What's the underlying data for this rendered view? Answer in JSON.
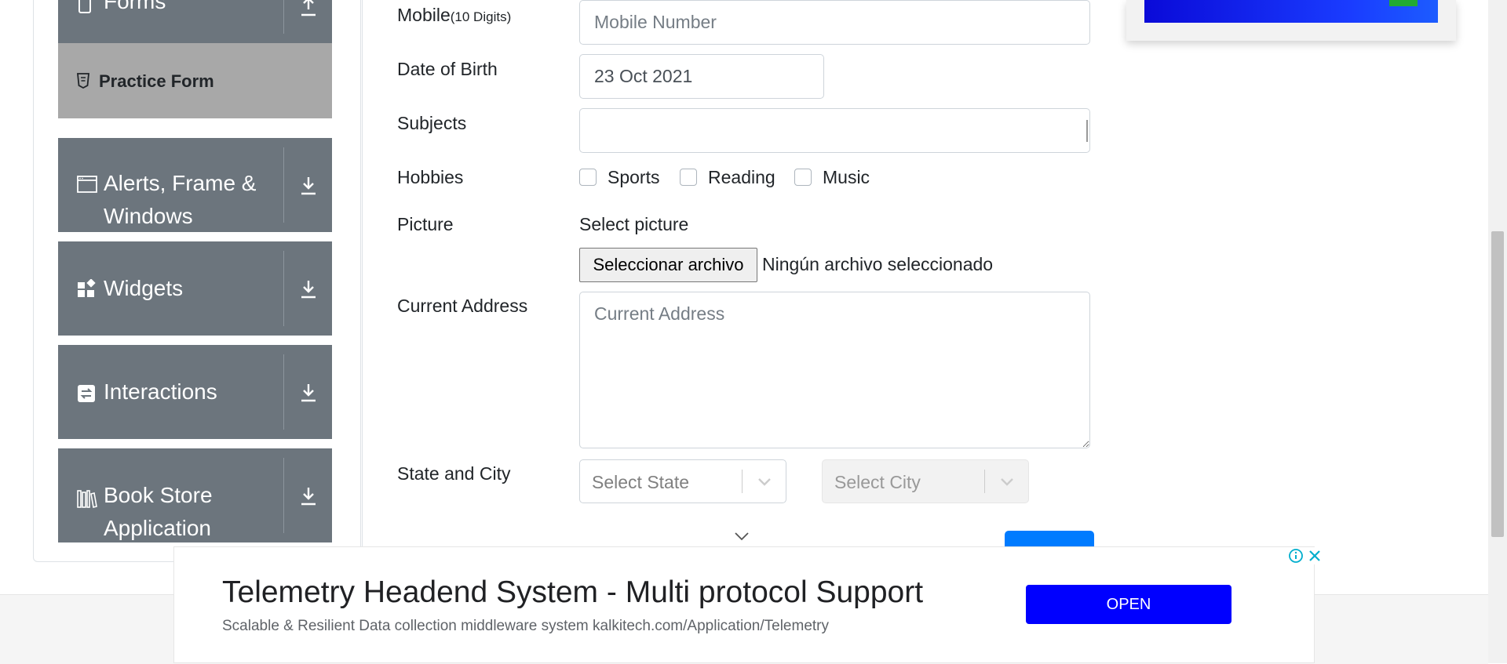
{
  "sidebar": {
    "forms_label": "Forms",
    "practice_form_label": "Practice Form",
    "groups": [
      {
        "label_line1": "Alerts, Frame &",
        "label_line2": "Windows",
        "icon": "window-icon"
      },
      {
        "label_line1": "Widgets",
        "label_line2": "",
        "icon": "widgets-icon"
      },
      {
        "label_line1": "Interactions",
        "label_line2": "",
        "icon": "interactions-icon"
      },
      {
        "label_line1": "Book Store",
        "label_line2": "Application",
        "icon": "book-store-icon"
      }
    ]
  },
  "form": {
    "mobile_label": "Mobile",
    "mobile_hint": "(10 Digits)",
    "mobile_placeholder": "Mobile Number",
    "dob_label": "Date of Birth",
    "dob_value": "23 Oct 2021",
    "subjects_label": "Subjects",
    "subjects_value": "",
    "hobbies_label": "Hobbies",
    "hobbies": [
      "Sports",
      "Reading",
      "Music"
    ],
    "picture_label": "Picture",
    "select_picture_label": "Select picture",
    "file_button_label": "Seleccionar archivo",
    "file_status": "Ningún archivo seleccionado",
    "address_label": "Current Address",
    "address_placeholder": "Current Address",
    "state_city_label": "State and City",
    "state_placeholder": "Select State",
    "city_placeholder": "Select City"
  },
  "ad": {
    "title": "Telemetry Headend System - Multi protocol Support",
    "subtitle": "Scalable & Resilient Data collection middleware system kalkitech.com/Application/Telemetry",
    "button_label": "OPEN"
  },
  "colors": {
    "sidebar_bg": "#6c757d",
    "active_bg": "#a8a8a8",
    "ad_button": "#0000ff",
    "submit_button": "#007bff"
  }
}
